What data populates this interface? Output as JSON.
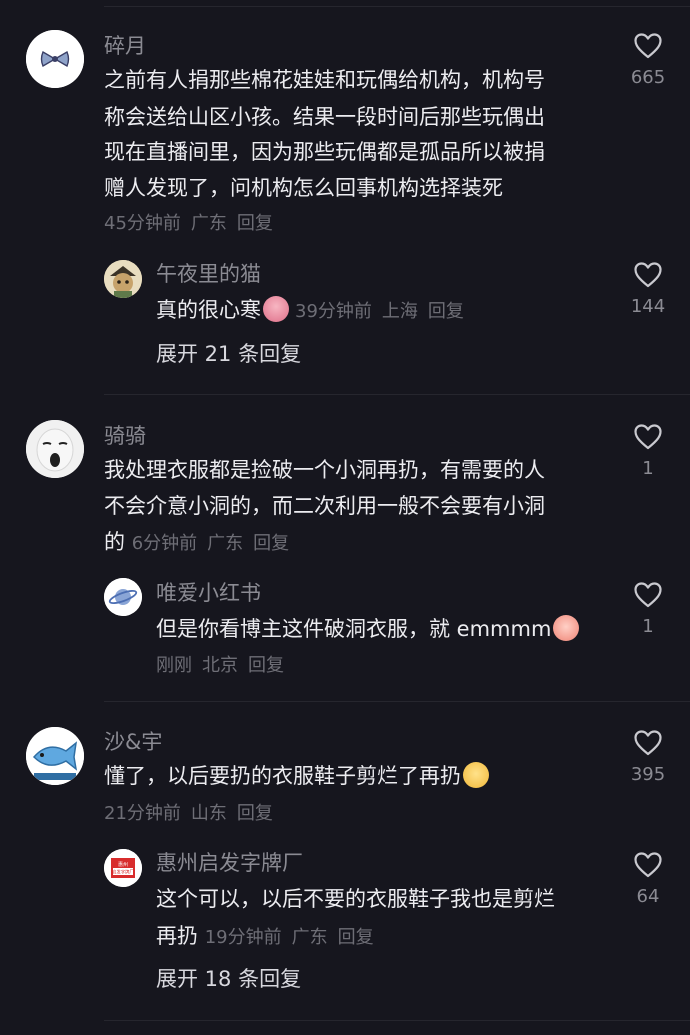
{
  "comments": [
    {
      "username": "碎月",
      "lines": [
        "之前有人捐那些棉花娃娃和玩偶给机构，机构号",
        "称会送给山区小孩。结果一段时间后那些玩偶出",
        "现在直播间里，因为那些玩偶都是孤品所以被捐",
        "赠人发现了，问机构怎么回事机构选择装死"
      ],
      "time": "45分钟前",
      "location": "广东",
      "reply_label": "回复",
      "likes": "665"
    },
    {
      "username": "午夜里的猫",
      "lines": [
        "真的很心寒"
      ],
      "time": "39分钟前",
      "location": "上海",
      "reply_label": "回复",
      "likes": "144",
      "expand_label": "展开 21 条回复"
    },
    {
      "username": "骑骑",
      "lines": [
        "我处理衣服都是捡破一个小洞再扔，有需要的人",
        "不会介意小洞的，而二次利用一般不会要有小洞",
        "的"
      ],
      "time": "6分钟前",
      "location": "广东",
      "reply_label": "回复",
      "likes": "1"
    },
    {
      "username": "唯爱小红书",
      "lines": [
        "但是你看博主这件破洞衣服，就 emmmm"
      ],
      "time": "刚刚",
      "location": "北京",
      "reply_label": "回复",
      "likes": "1"
    },
    {
      "username": "沙&宇",
      "lines": [
        "懂了，以后要扔的衣服鞋子剪烂了再扔"
      ],
      "time": "21分钟前",
      "location": "山东",
      "reply_label": "回复",
      "likes": "395"
    },
    {
      "username": "惠州启发字牌厂",
      "lines": [
        "这个可以，以后不要的衣服鞋子我也是剪烂",
        "再扔"
      ],
      "time": "19分钟前",
      "location": "广东",
      "reply_label": "回复",
      "likes": "64",
      "expand_label": "展开 18 条回复",
      "avatar_text": "惠州 启发字牌厂"
    }
  ],
  "colors": {
    "background": "#16161e",
    "text": "#ececf0",
    "secondary": "#8b8b93",
    "meta": "#6e6e76"
  },
  "icons": {
    "like": "heart-outline-icon",
    "emoji_cold": "cold-face-emoji",
    "emoji_peach": "peach-face-emoji",
    "emoji_cat": "cat-face-emoji"
  }
}
